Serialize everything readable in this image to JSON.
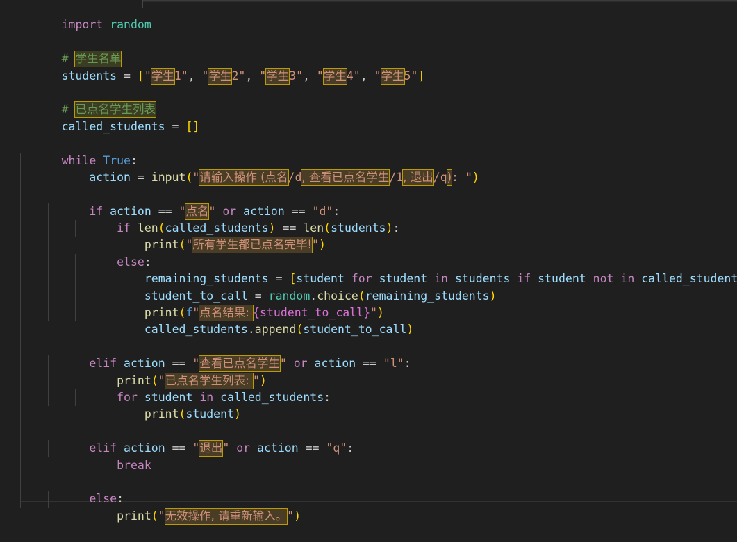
{
  "editor": {
    "language": "python",
    "theme": "dark-modern",
    "background": "#1f1f1f",
    "font_size_px": 16.5,
    "colors": {
      "keyword": "#c586c0",
      "keyword_blue": "#569cd6",
      "identifier": "#9cdcfe",
      "module": "#4ec9b0",
      "function": "#dcdcaa",
      "string": "#ce9178",
      "number": "#b5cea8",
      "comment": "#6a9955",
      "punctuation": "#cccccc",
      "bracket_level_0": "#ffd700",
      "bracket_level_1": "#da70d6",
      "bracket_level_2": "#179fff",
      "unicode_highlight_border": "#bb9b00",
      "unicode_highlight_string_bg": "#4a3d26",
      "unicode_highlight_comment_bg": "#3a3d21",
      "indent_guide": "#404040"
    }
  },
  "code": {
    "tokens": {
      "import": "import",
      "random": "random",
      "hash": "#",
      "students_ident": "students",
      "called_students_ident": "called_students",
      "assign": " = ",
      "while": "while",
      "true": "True",
      "colon": ":",
      "action": "action",
      "input": "input",
      "if": "if",
      "elif": "elif",
      "else": "else",
      "or": "or",
      "for": "for",
      "in": "in",
      "not": "not",
      "break": "break",
      "len": "len",
      "print": "print",
      "student": "student",
      "remaining_students": "remaining_students",
      "student_to_call": "student_to_call",
      "choice": "choice",
      "append": "append",
      "eqeq": " == ",
      "f_prefix": "f",
      "dot": "."
    },
    "comments": {
      "student_list": "学生名单",
      "called_list": "已点名学生列表"
    },
    "strings": {
      "student_prefix": "学生",
      "student_nums": [
        "1",
        "2",
        "3",
        "4",
        "5"
      ],
      "input_prompt_part1": "请输入操作 (点名",
      "input_prompt_sep1": "/d",
      "input_prompt_part2": ", 查看已点名学生",
      "input_prompt_sep2": "/1",
      "input_prompt_part3": ", 退出",
      "input_prompt_sep3": "/q",
      "input_prompt_part4": ")",
      "input_prompt_tail": ": ",
      "call_action": "点名",
      "call_action_short": "d",
      "all_called": "所有学生都已点名完毕!",
      "call_result": "点名结果: ",
      "view_action": "查看已点名学生",
      "view_action_short": "l",
      "called_list_label": "已点名学生列表: ",
      "quit_action": "退出",
      "quit_action_short": "q",
      "invalid_action": "无效操作, 请重新输入。"
    },
    "interpolation": {
      "student_to_call": "{student_to_call}"
    },
    "empty_list": "[]"
  }
}
